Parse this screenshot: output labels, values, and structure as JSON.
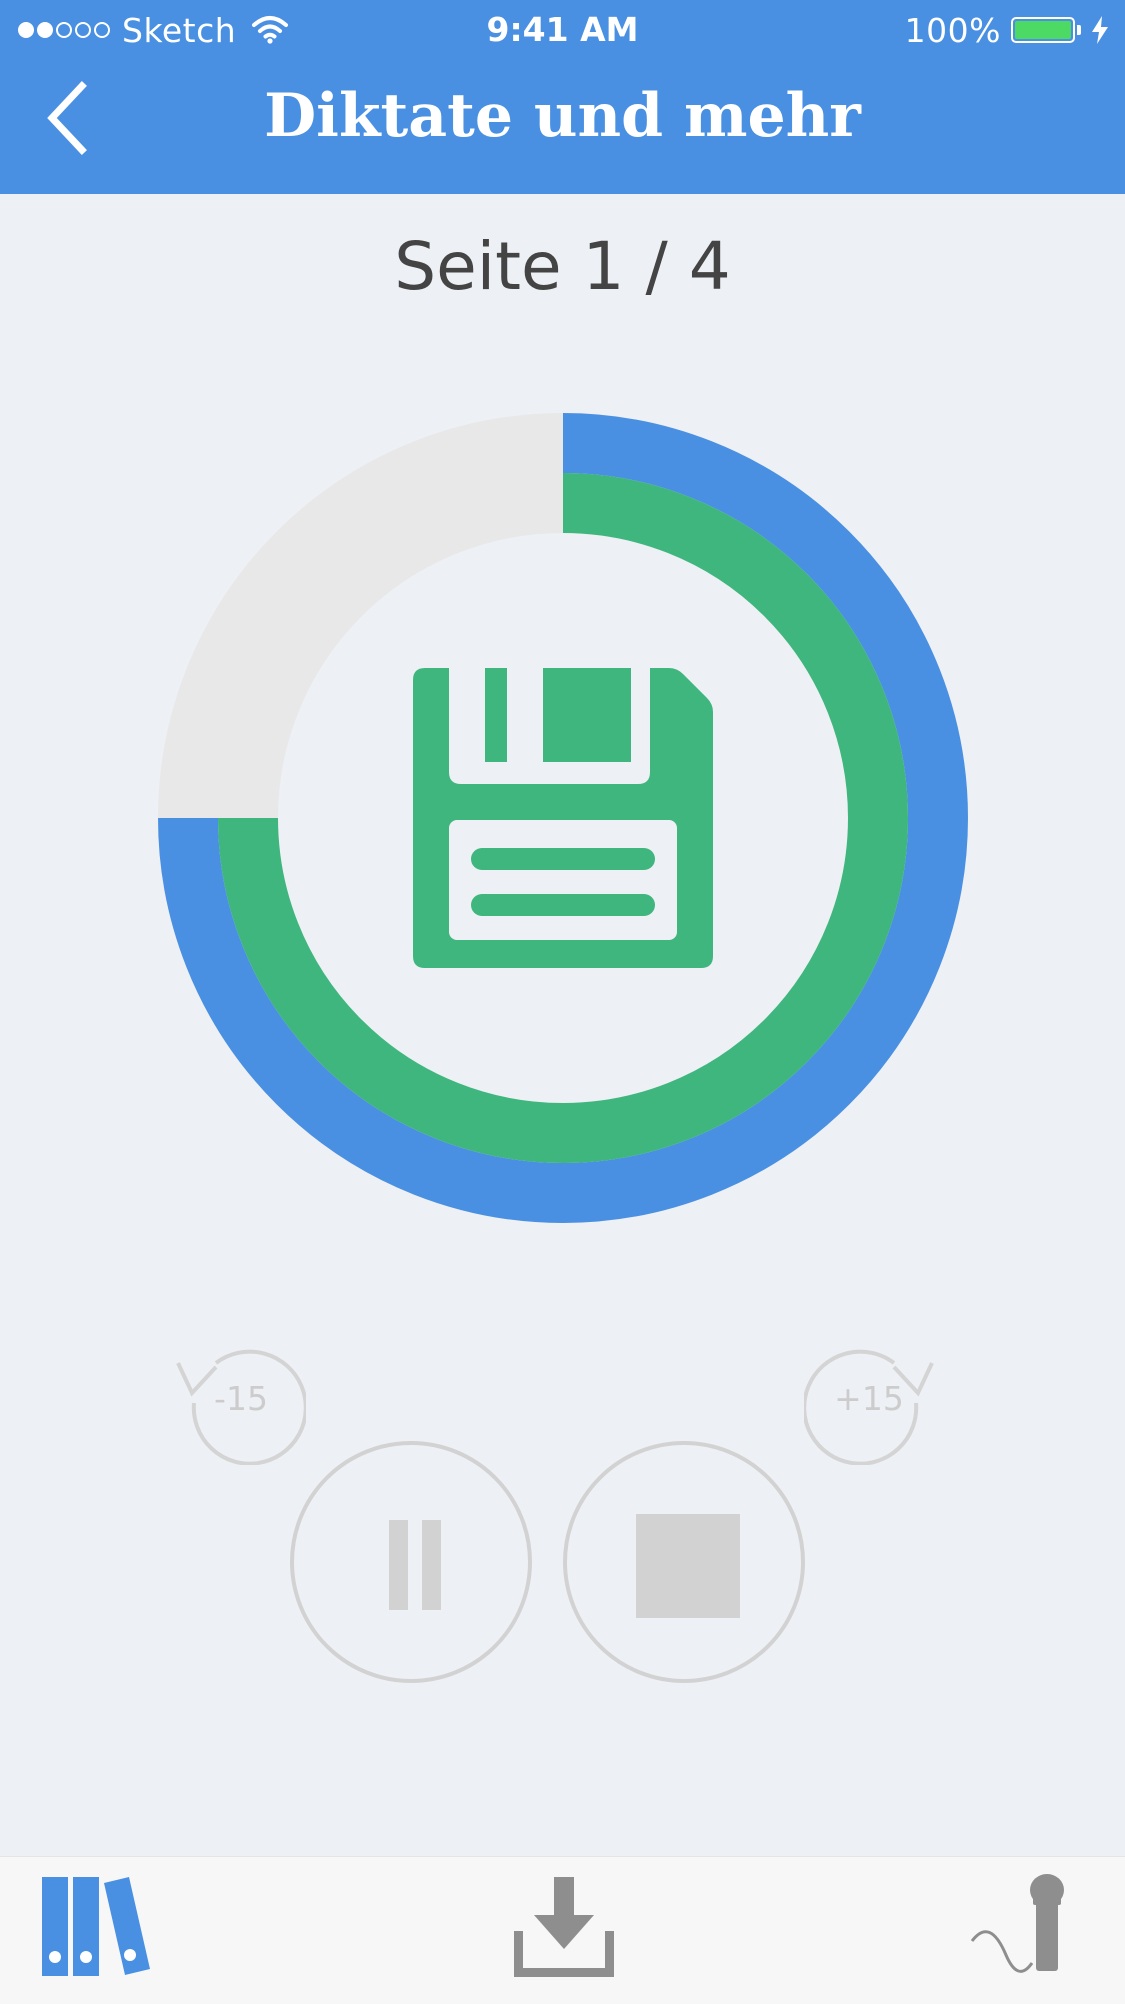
{
  "status_bar": {
    "carrier": "Sketch",
    "signal_filled": 2,
    "signal_total": 5,
    "time": "9:41 AM",
    "battery": "100%",
    "battery_level": 1.0,
    "icons": [
      "signal-dots-icon",
      "wifi-icon",
      "battery-icon",
      "charging-bolt-icon"
    ]
  },
  "header": {
    "title": "Diktate und mehr",
    "back_icon": "chevron-left-icon"
  },
  "page_indicator": "Seite 1 / 4",
  "progress": {
    "outer_ring_fraction": 0.75,
    "inner_ring_fraction": 0.75,
    "center_icon": "floppy-disk-save-icon"
  },
  "controls": {
    "rewind_label": "-15",
    "forward_label": "+15",
    "pause_icon": "pause-icon",
    "stop_icon": "stop-icon"
  },
  "tabbar": {
    "items": [
      {
        "icon": "library-books-icon"
      },
      {
        "icon": "download-icon"
      },
      {
        "icon": "microphone-icon"
      }
    ]
  },
  "colors": {
    "header_blue": "#4A90E2",
    "ring_blue": "#4A90E2",
    "ring_green": "#3EB67E",
    "ring_gray": "#E8E8E8",
    "background": "#EDF0F4",
    "control_gray": "#D2D2D2",
    "tab_icon_gray": "#8E8E8E"
  }
}
